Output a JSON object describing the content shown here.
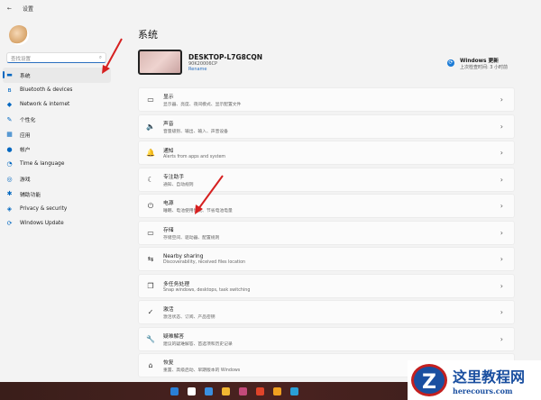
{
  "window": {
    "back": "←",
    "title": "设置"
  },
  "sidebar": {
    "search_placeholder": "查找设置",
    "items": [
      {
        "label": "系统",
        "icon": "▬"
      },
      {
        "label": "Bluetooth & devices",
        "icon": "ʙ"
      },
      {
        "label": "Network & internet",
        "icon": "◆"
      },
      {
        "label": "个性化",
        "icon": "✎"
      },
      {
        "label": "应用",
        "icon": "▦"
      },
      {
        "label": "帐户",
        "icon": "●"
      },
      {
        "label": "Time & language",
        "icon": "◔"
      },
      {
        "label": "游戏",
        "icon": "◎"
      },
      {
        "label": "辅助功能",
        "icon": "✱"
      },
      {
        "label": "Privacy & security",
        "icon": "◈"
      },
      {
        "label": "Windows Update",
        "icon": "⟳"
      }
    ]
  },
  "main": {
    "title": "系统",
    "device": {
      "name": "DESKTOP-L7G8CQN",
      "model": "90K20006CP",
      "rename": "Rename"
    },
    "update": {
      "title": "Windows 更新",
      "subtitle": "上次检查时间: 3 小时前"
    },
    "cards": [
      {
        "title": "显示",
        "sub": "显示器、亮度、夜间模式、显示配置文件",
        "icon": "▭"
      },
      {
        "title": "声音",
        "sub": "音量级别、输出、输入、声音设备",
        "icon": "🔈"
      },
      {
        "title": "通知",
        "sub": "Alerts from apps and system",
        "icon": "🔔"
      },
      {
        "title": "专注助手",
        "sub": "通知、自动规则",
        "icon": "☾"
      },
      {
        "title": "电源",
        "sub": "睡眠、电池使用情况、节省电池电量",
        "icon": "⏻"
      },
      {
        "title": "存储",
        "sub": "存储空间、驱动器、配置规则",
        "icon": "▭"
      },
      {
        "title": "Nearby sharing",
        "sub": "Discoverability, received files location",
        "icon": "⇆"
      },
      {
        "title": "多任务处理",
        "sub": "Snap windows, desktops, task switching",
        "icon": "❐"
      },
      {
        "title": "激活",
        "sub": "激活状态、订阅、产品密钥",
        "icon": "✓"
      },
      {
        "title": "疑难解答",
        "sub": "建议的疑难解答、首选项和历史记录",
        "icon": "🔧"
      },
      {
        "title": "恢复",
        "sub": "重置、高级启动、早期版本的 Windows",
        "icon": "⌂"
      }
    ],
    "chevron": "›"
  },
  "watermark": {
    "logo": "Z",
    "name": "这里教程网",
    "url": "herecours.com"
  },
  "taskbar_colors": [
    "#2a7fd6",
    "#ffffff",
    "#3a8fe0",
    "#f2b632",
    "#c44a7a",
    "#e0442a",
    "#f0a020",
    "#2a9fd6"
  ]
}
